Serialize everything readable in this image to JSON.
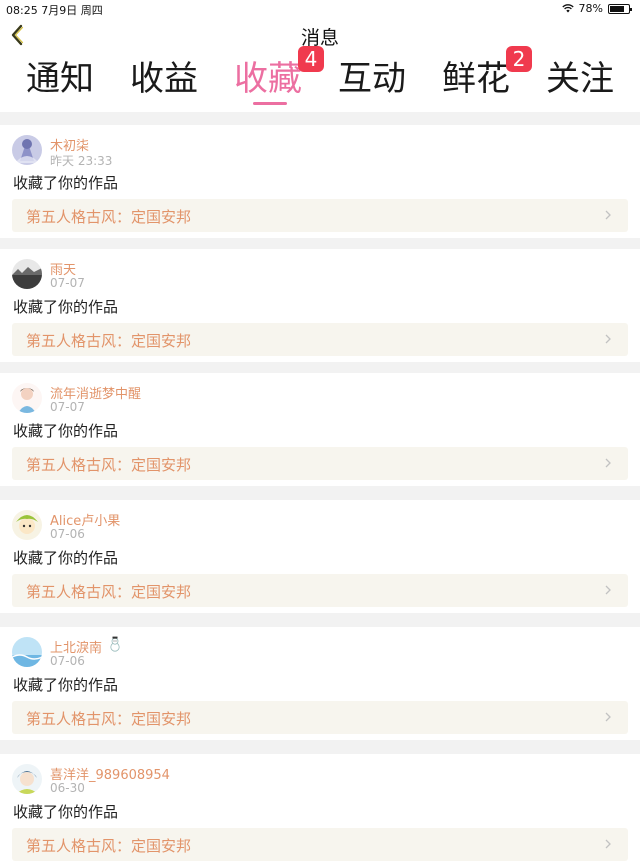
{
  "status_bar": {
    "time_date": "08:25  7月9日 周四",
    "battery": "78%",
    "battery_level": 0.78
  },
  "nav": {
    "title": "消息"
  },
  "tabs": [
    {
      "label": "通知"
    },
    {
      "label": "收益"
    },
    {
      "label": "收藏",
      "active": true,
      "badge": "4"
    },
    {
      "label": "互动"
    },
    {
      "label": "鲜花",
      "badge": "2"
    },
    {
      "label": "关注"
    }
  ],
  "items": [
    {
      "user": "木初柒",
      "time": "昨天 23:33",
      "action": "收藏了你的作品",
      "work": "第五人格古风：定国安邦"
    },
    {
      "user": "雨天",
      "time": "07-07",
      "action": "收藏了你的作品",
      "work": "第五人格古风：定国安邦"
    },
    {
      "user": "流年消逝梦中醒",
      "time": "07-07",
      "action": "收藏了你的作品",
      "work": "第五人格古风：定国安邦"
    },
    {
      "user": "Alice卢小果",
      "time": "07-06",
      "action": "收藏了你的作品",
      "work": "第五人格古风：定国安邦"
    },
    {
      "user": "上北淚南",
      "time": "07-06",
      "action": "收藏了你的作品",
      "work": "第五人格古风：定国安邦"
    },
    {
      "user": "喜洋洋_989608954",
      "time": "06-30",
      "action": "收藏了你的作品",
      "work": "第五人格古风：定国安邦"
    }
  ],
  "colors": {
    "accent": "#ec6fa1",
    "badge": "#f03a4e",
    "username": "#e2946a",
    "work_bg": "#f7f5ee"
  },
  "icons": {
    "back": "chevron-left-icon",
    "wifi": "wifi-icon",
    "battery": "battery-icon",
    "snowman": "snowman-emoji-icon",
    "chevron": "chevron-right-icon"
  }
}
